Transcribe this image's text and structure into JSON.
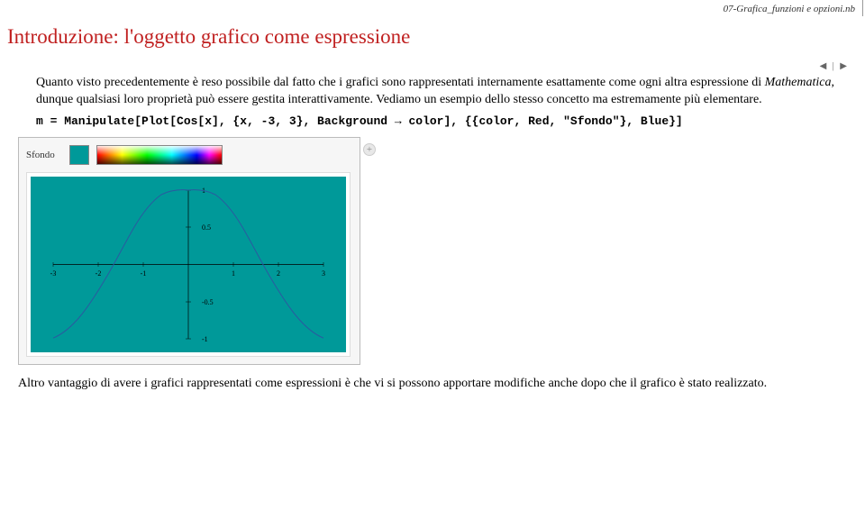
{
  "file_header": "07-Grafica_funzioni e opzioni.nb",
  "section_title": "Introduzione: l'oggetto grafico come espressione",
  "nav": {
    "prev": "◀",
    "sep": "|",
    "next": "▶"
  },
  "paragraph1": "Quanto visto precedentemente è reso possibile dal fatto che i grafici sono rappresentati internamente esattamente come ogni altra espressione di ",
  "mathematica": "Mathematica",
  "paragraph1b": ", dunque qualsiasi loro proprietà può essere gestita interattivamente. Vediamo un esempio dello stesso concetto ma estremamente più elementare.",
  "code": "m = Manipulate[Plot[Cos[x], {x, -3, 3}, Background → color], {{color, Red, \"Sfondo\"}, Blue}]",
  "manipulate": {
    "control_label": "Sfondo",
    "plus": "+",
    "swatch_color": "#009999"
  },
  "chart_data": {
    "type": "line",
    "function": "Cos[x]",
    "xrange": [
      -3,
      3
    ],
    "yrange": [
      -1.0,
      1.0
    ],
    "x_ticks": [
      -3,
      -2,
      -1,
      1,
      2,
      3
    ],
    "y_ticks": [
      -1.0,
      -0.5,
      0.5,
      1.0
    ],
    "background": "#009999",
    "curve_color": "#2a5aa0"
  },
  "paragraph2": "Altro vantaggio di avere i grafici rappresentati come espressioni è che vi si possono apportare modifiche anche dopo che il grafico è stato realizzato."
}
